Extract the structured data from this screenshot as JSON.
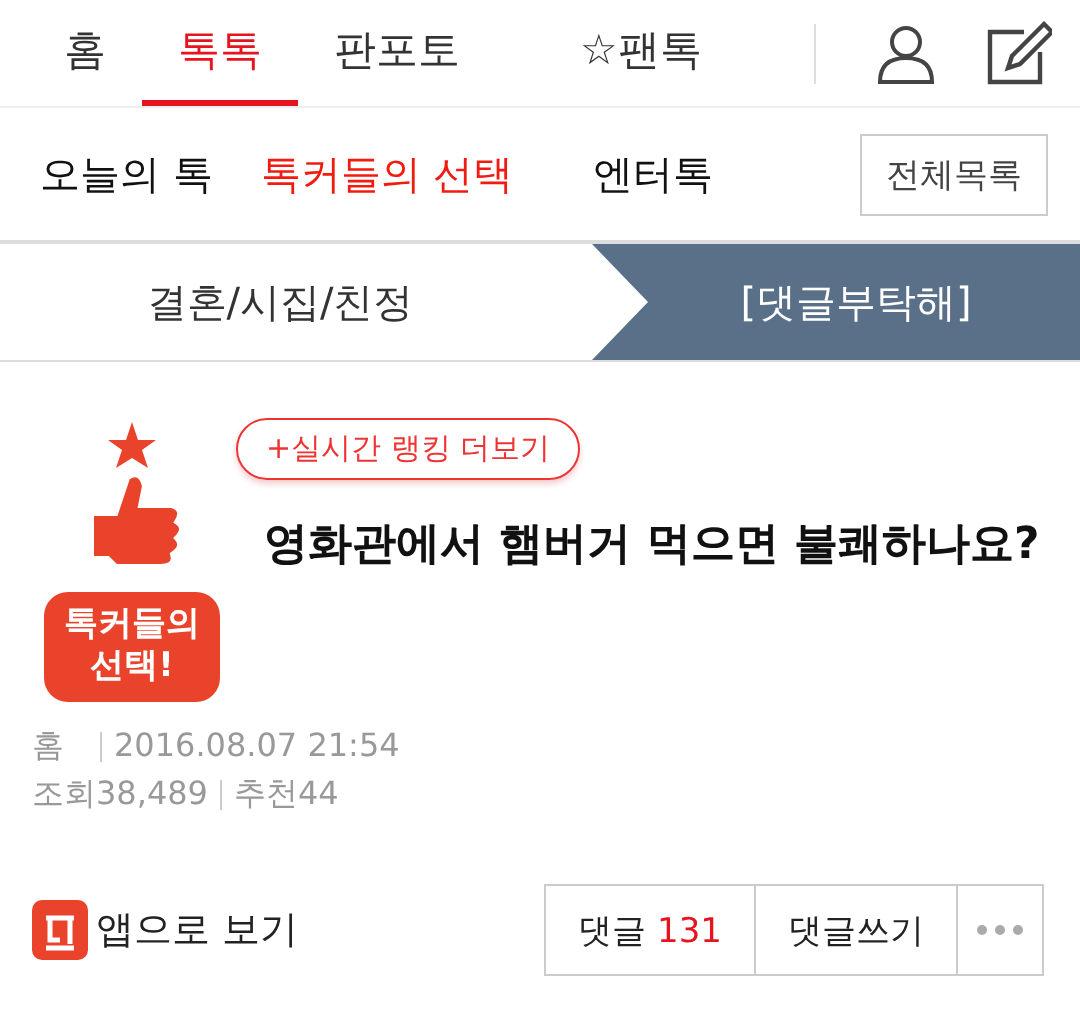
{
  "top_nav": {
    "tabs": [
      {
        "label": "홈",
        "selected": false
      },
      {
        "label": "톡톡",
        "selected": true
      },
      {
        "label": "판포토",
        "selected": false
      },
      {
        "label": "☆팬톡",
        "selected": false
      }
    ]
  },
  "sub_nav": {
    "tabs": [
      {
        "label": "오늘의 톡",
        "selected": false
      },
      {
        "label": "톡커들의 선택",
        "selected": true
      },
      {
        "label": "엔터톡",
        "selected": false
      }
    ],
    "all_button": "전체목록"
  },
  "breadcrumb": {
    "category": "결혼/시집/친정",
    "subcategory": "[댓글부탁해]"
  },
  "article": {
    "badge_text": [
      "톡커들의",
      "선택!"
    ],
    "ranking_link": "+실시간 랭킹 더보기",
    "title": "영화관에서 햄버거 먹으면 불쾌하나요?",
    "board": "홈",
    "date": "2016.08.07 21:54",
    "views": "조회38,489",
    "likes": "추천44"
  },
  "footer": {
    "app_link": "앱으로 보기",
    "comment_label": "댓글",
    "comment_count": "131",
    "write_button": "댓글쓰기"
  }
}
